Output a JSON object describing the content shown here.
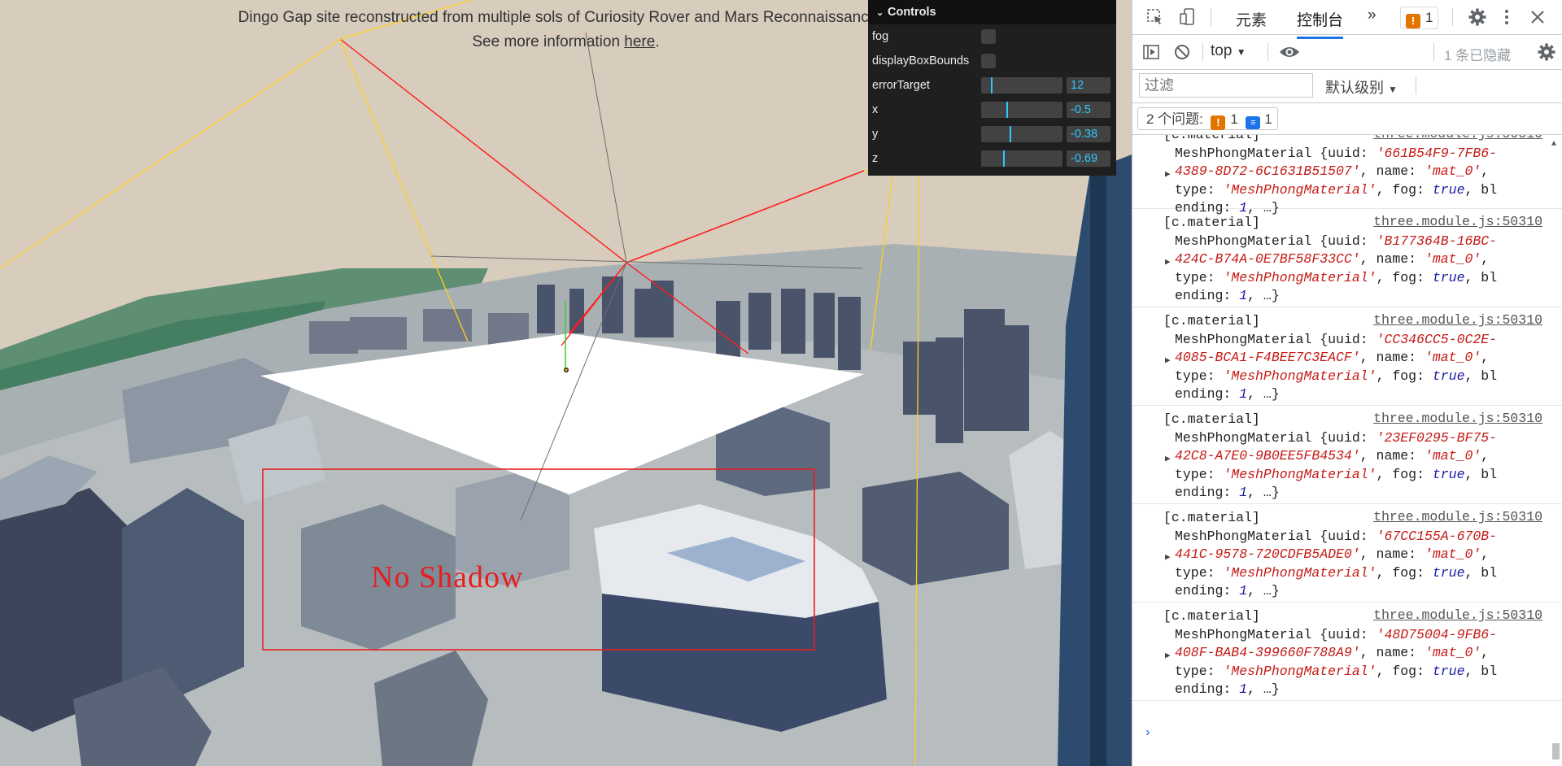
{
  "viewport": {
    "info_text": "Dingo Gap site reconstructed from multiple sols of Curiosity Rover and Mars Reconnaissance O",
    "info_see_more": "See more information ",
    "info_link": "here",
    "info_period": ".",
    "annotation_label": "No Shadow",
    "annotation_color": "#e51f1f"
  },
  "gui": {
    "title": "Controls",
    "chevron": "⌄",
    "controls": [
      {
        "label": "fog",
        "type": "checkbox",
        "checked": false
      },
      {
        "label": "displayBoxBounds",
        "type": "checkbox",
        "checked": false
      },
      {
        "label": "errorTarget",
        "type": "slider",
        "value": "12",
        "fill": 0.12
      },
      {
        "label": "x",
        "type": "slider",
        "value": "-0.5",
        "fill": 0.32
      },
      {
        "label": "y",
        "type": "slider",
        "value": "-0.38",
        "fill": 0.36
      },
      {
        "label": "z",
        "type": "slider",
        "value": "-0.69",
        "fill": 0.28
      }
    ],
    "accent": "#2cc9ff"
  },
  "devtools": {
    "tabs": [
      {
        "label": "元素",
        "active": false
      },
      {
        "label": "控制台",
        "active": true
      }
    ],
    "more_tabs": "»",
    "warning_count": "1",
    "toolbar": {
      "context": "top",
      "hidden_count": "1 条已隐藏"
    },
    "filter": {
      "placeholder": "过滤",
      "level": "默认级别"
    },
    "issues": {
      "label": "2 个问题:",
      "warnings": "1",
      "infos": "1"
    },
    "console": {
      "source": "three.module.js:50310",
      "entries": [
        {
          "tag": "[c.material]",
          "uuid_a": "661B54F9-7FB6-",
          "uuid_b": "4389-8D72-6C1631B51507"
        },
        {
          "tag": "[c.material]",
          "uuid_a": "B177364B-16BC-",
          "uuid_b": "424C-B74A-0E7BF58F33CC"
        },
        {
          "tag": "[c.material]",
          "uuid_a": "CC346CC5-0C2E-",
          "uuid_b": "4085-BCA1-F4BEE7C3EACF"
        },
        {
          "tag": "[c.material]",
          "uuid_a": "23EF0295-BF75-",
          "uuid_b": "42C8-A7E0-9B0EE5FB4534"
        },
        {
          "tag": "[c.material]",
          "uuid_a": "67CC155A-670B-",
          "uuid_b": "441C-9578-720CDFB5ADE0"
        },
        {
          "tag": "[c.material]",
          "uuid_a": "48D75004-9FB6-",
          "uuid_b": "408F-BAB4-399660F788A9"
        }
      ],
      "class_name": "MeshPhongMaterial",
      "name_value": "'mat_0'",
      "type_value": "'MeshPhongMaterial'",
      "fog_value": "true",
      "blending_value": "1",
      "prompt": "›"
    }
  }
}
